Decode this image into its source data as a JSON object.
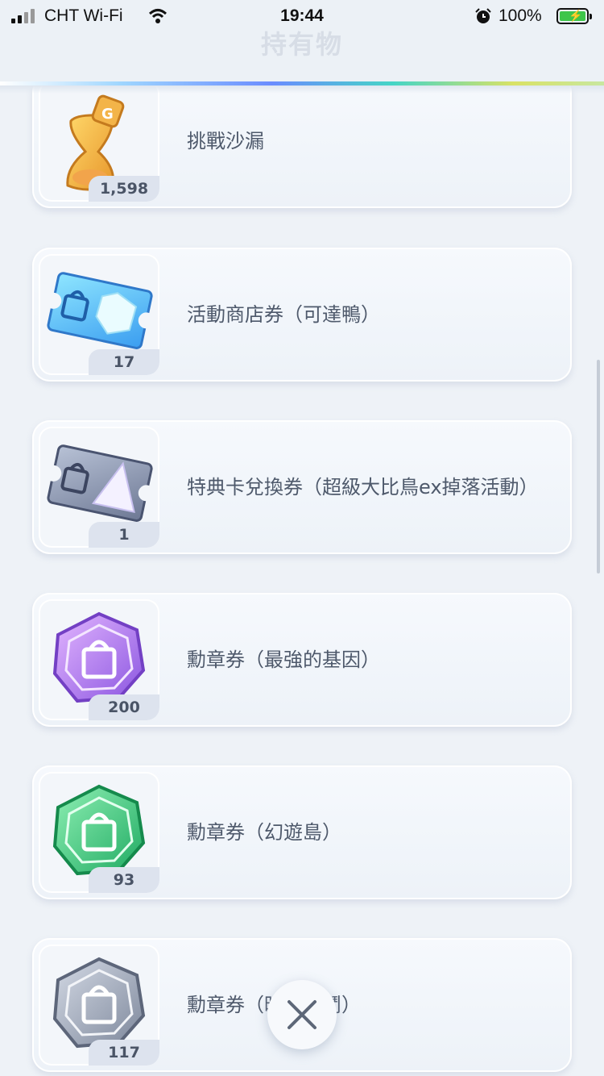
{
  "status_bar": {
    "carrier": "CHT Wi-Fi",
    "time": "19:44",
    "battery_percent": "100%",
    "icons": [
      "signal-icon",
      "wifi-icon",
      "alarm-icon",
      "battery-charging-icon"
    ]
  },
  "header": {
    "title": "持有物"
  },
  "items": [
    {
      "name": "挑戰沙漏",
      "count": "1,598",
      "icon": "hourglass-icon"
    },
    {
      "name": "活動商店券（可達鴨）",
      "count": "17",
      "icon": "event-shop-ticket-icon"
    },
    {
      "name": "特典卡兌換券（超級大比鳥ex掉落活動）",
      "count": "1",
      "icon": "promo-card-ticket-icon"
    },
    {
      "name": "勳章券（最強的基因）",
      "count": "200",
      "icon": "medal-ticket-purple-icon"
    },
    {
      "name": "勳章券（幻遊島）",
      "count": "93",
      "icon": "medal-ticket-green-icon"
    },
    {
      "name": "勳章券（時空激鬥）",
      "count": "117",
      "icon": "medal-ticket-gray-icon"
    }
  ],
  "close_button": {
    "icon": "close-icon"
  },
  "colors": {
    "background": "#eef2f7",
    "text": "#4e596b",
    "badge": "#dde3ee",
    "accent_gradient": [
      "#9fd6ff",
      "#6a8cff",
      "#45d5c6",
      "#d9e266"
    ]
  }
}
